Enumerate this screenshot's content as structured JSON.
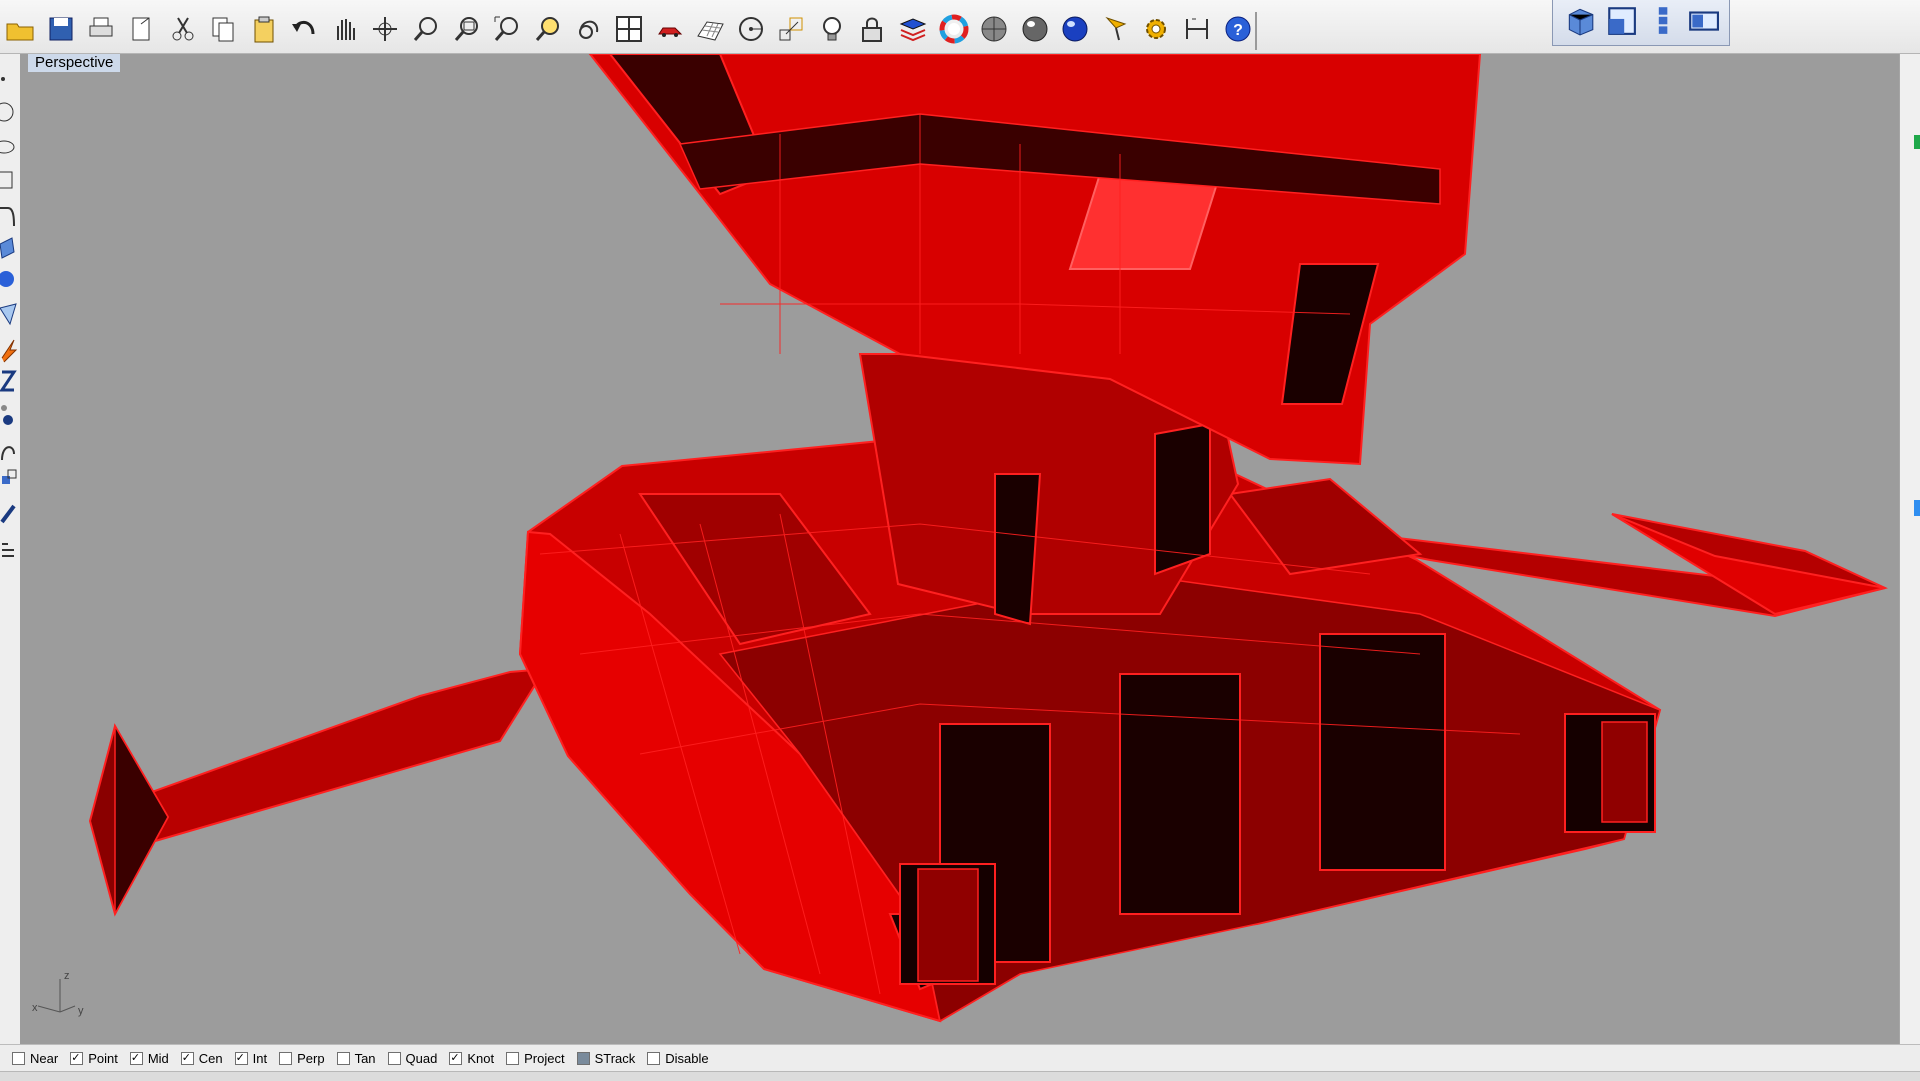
{
  "viewport": {
    "title": "Perspective",
    "background": "#9c9c9c"
  },
  "toolbar": {
    "icons": [
      "open-icon",
      "save-icon",
      "print-icon",
      "import-icon",
      "cut-icon",
      "copy-icon",
      "paste-icon",
      "undo-icon",
      "pan-icon",
      "rotate-view-icon",
      "zoom-icon",
      "zoom-window-icon",
      "zoom-extents-icon",
      "zoom-selected-icon",
      "undo-view-icon",
      "four-viewports-icon",
      "car-icon",
      "grid-icon",
      "circle-point-icon",
      "scale-icon",
      "light-bulb-icon",
      "lock-icon",
      "layer-icon",
      "color-wheel-icon",
      "sphere-shaded-icon",
      "sphere-rendered-icon",
      "sphere-blue-icon",
      "cursor-flag-icon",
      "gear-icon",
      "dimension-icon",
      "help-icon"
    ]
  },
  "view_toolbar": {
    "icons": [
      "perspective-box-icon",
      "top-view-icon",
      "vertical-toolbar-icon",
      "split-view-icon"
    ]
  },
  "osnaps": [
    {
      "label": "Near",
      "checked": false
    },
    {
      "label": "Point",
      "checked": true
    },
    {
      "label": "Mid",
      "checked": true
    },
    {
      "label": "Cen",
      "checked": true
    },
    {
      "label": "Int",
      "checked": true
    },
    {
      "label": "Perp",
      "checked": false
    },
    {
      "label": "Tan",
      "checked": false
    },
    {
      "label": "Quad",
      "checked": false
    },
    {
      "label": "Knot",
      "checked": true
    },
    {
      "label": "Project",
      "checked": false
    },
    {
      "label": "STrack",
      "checked": false,
      "filled": true
    },
    {
      "label": "Disable",
      "checked": false
    }
  ],
  "axes": {
    "z": "z",
    "x": "x",
    "y": "y"
  },
  "colors": {
    "model_red": "#e00000",
    "model_dark": "#5a0000",
    "edge": "#ff1a1a"
  }
}
